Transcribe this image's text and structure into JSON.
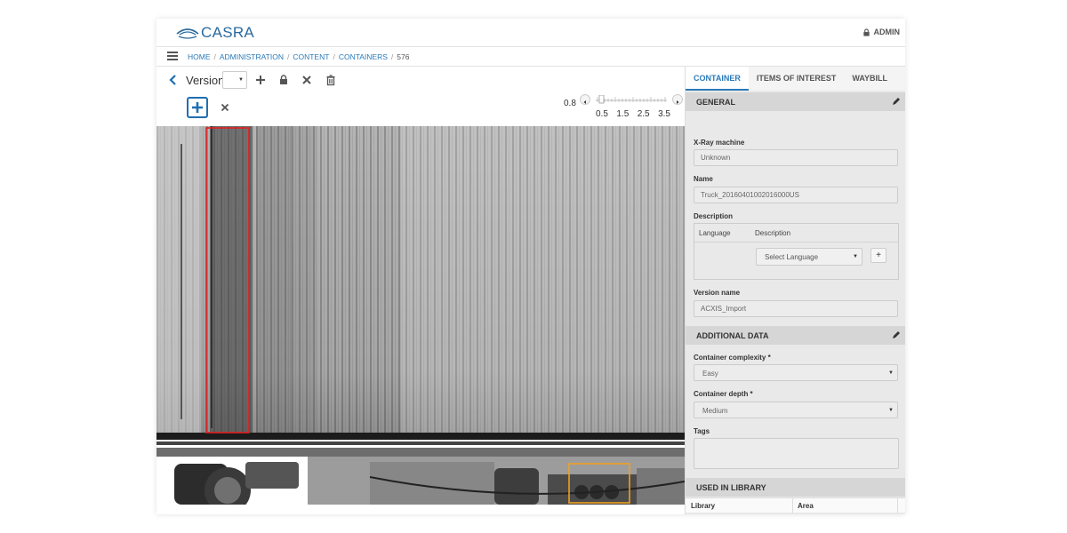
{
  "header": {
    "logo_text": "CASRA",
    "user_label": "ADMIN",
    "user_icon": "lock-icon"
  },
  "breadcrumb": {
    "items": [
      "HOME",
      "ADMINISTRATION",
      "CONTENT",
      "CONTAINERS"
    ],
    "current": "576"
  },
  "toolbar": {
    "version_label": "Version",
    "version_value": "",
    "icons": [
      "back-icon",
      "plus-icon",
      "lock-icon",
      "close-icon",
      "trash-icon"
    ]
  },
  "zoom": {
    "current": "0.8",
    "ticks": [
      "0.5",
      "1.5",
      "2.5",
      "3.5"
    ]
  },
  "tabs": [
    {
      "label": "CONTAINER",
      "active": true
    },
    {
      "label": "ITEMS OF INTEREST",
      "active": false
    },
    {
      "label": "WAYBILL",
      "active": false
    }
  ],
  "general": {
    "title": "GENERAL",
    "xray_label": "X-Ray machine",
    "xray_value": "Unknown",
    "name_label": "Name",
    "name_value": "Truck_20160401002016000US",
    "description_label": "Description",
    "desc_col_language": "Language",
    "desc_col_description": "Description",
    "language_select": "Select Language",
    "add_label": "+",
    "version_name_label": "Version name",
    "version_name_value": "ACXIS_Import"
  },
  "additional": {
    "title": "ADDITIONAL DATA",
    "complexity_label": "Container complexity *",
    "complexity_value": "Easy",
    "depth_label": "Container depth *",
    "depth_value": "Medium",
    "tags_label": "Tags"
  },
  "library": {
    "title": "USED IN LIBRARY",
    "col_library": "Library",
    "col_area": "Area"
  },
  "colors": {
    "accent": "#2a7ab9",
    "selection_red": "#e02020",
    "selection_orange": "#f0a020"
  }
}
